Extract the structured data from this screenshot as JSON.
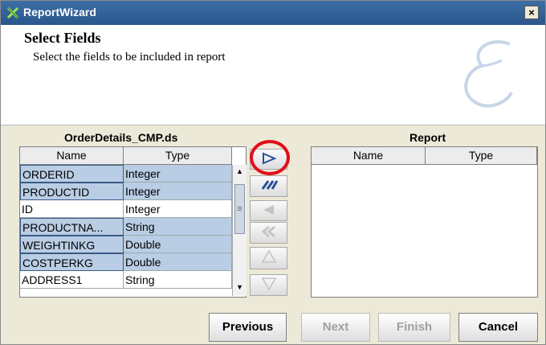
{
  "window": {
    "title": "ReportWizard",
    "close_glyph": "×"
  },
  "header": {
    "title": "Select Fields",
    "subtitle": "Select the fields to be included in report"
  },
  "source": {
    "label": "OrderDetails_CMP.ds",
    "columns": [
      "Name",
      "Type"
    ],
    "rows": [
      {
        "name": "ORDERID",
        "type": "Integer",
        "selected": true
      },
      {
        "name": "PRODUCTID",
        "type": "Integer",
        "selected": true
      },
      {
        "name": "ID",
        "type": "Integer",
        "selected": false
      },
      {
        "name": "PRODUCTNA...",
        "type": "String",
        "selected": true
      },
      {
        "name": "WEIGHTINKG",
        "type": "Double",
        "selected": true
      },
      {
        "name": "COSTPERKG",
        "type": "Double",
        "selected": true
      },
      {
        "name": "ADDRESS1",
        "type": "String",
        "selected": false
      }
    ]
  },
  "report": {
    "label": "Report",
    "columns": [
      "Name",
      "Type"
    ]
  },
  "move_buttons": [
    {
      "icon": "add-one-icon",
      "enabled": true
    },
    {
      "icon": "add-all-icon",
      "enabled": true
    },
    {
      "icon": "remove-one-icon",
      "enabled": false
    },
    {
      "icon": "remove-all-icon",
      "enabled": false
    },
    {
      "icon": "move-up-icon",
      "enabled": false
    },
    {
      "icon": "move-down-icon",
      "enabled": false
    }
  ],
  "footer": {
    "previous": "Previous",
    "next": "Next",
    "finish": "Finish",
    "cancel": "Cancel"
  },
  "colors": {
    "title_bar": "#2f5f98",
    "selected_row": "#b9cde4",
    "highlight_circle": "#e30d1b"
  }
}
